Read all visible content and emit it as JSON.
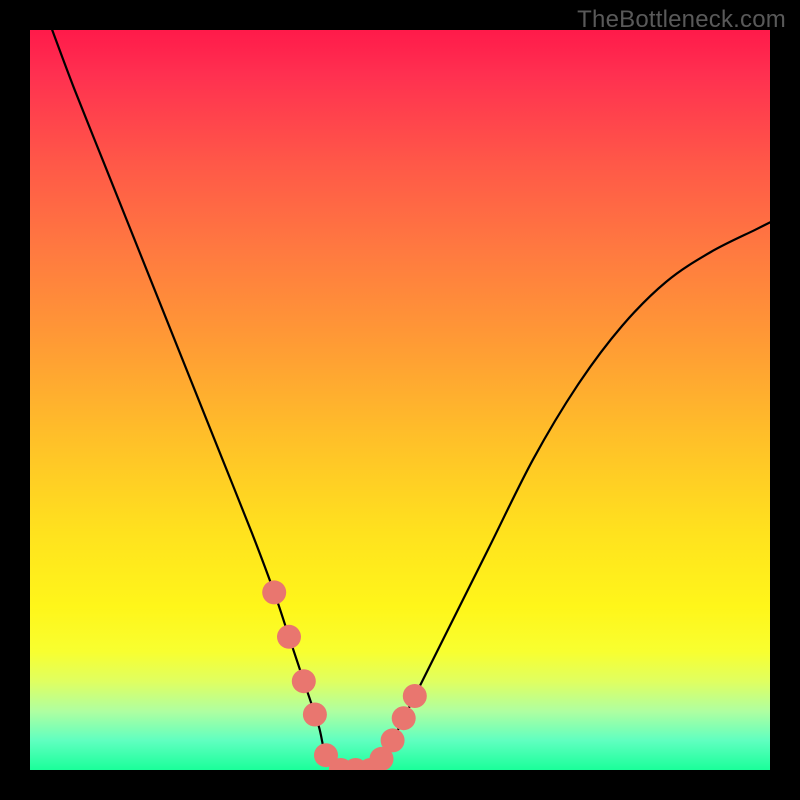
{
  "watermark": "TheBottleneck.com",
  "chart_data": {
    "type": "line",
    "title": "",
    "xlabel": "",
    "ylabel": "",
    "xlim": [
      0,
      100
    ],
    "ylim": [
      0,
      100
    ],
    "grid": false,
    "series": [
      {
        "name": "bottleneck-curve",
        "x": [
          3,
          6,
          10,
          14,
          18,
          22,
          26,
          30,
          33,
          35,
          37,
          39,
          40,
          42,
          44,
          46,
          48,
          50,
          53,
          57,
          62,
          68,
          74,
          80,
          86,
          92,
          98,
          100
        ],
        "y": [
          100,
          92,
          82,
          72,
          62,
          52,
          42,
          32,
          24,
          18,
          12,
          6,
          2,
          0,
          0,
          0,
          2,
          6,
          12,
          20,
          30,
          42,
          52,
          60,
          66,
          70,
          73,
          74
        ]
      }
    ],
    "annotations": {
      "curve_color": "#000000",
      "gradient_stops": [
        {
          "pos": 0.0,
          "color": "#ff1a4a"
        },
        {
          "pos": 0.5,
          "color": "#ffc228"
        },
        {
          "pos": 0.8,
          "color": "#fff61a"
        },
        {
          "pos": 1.0,
          "color": "#1aff9a"
        }
      ],
      "highlight_markers": {
        "color": "#e9766f",
        "points_x": [
          33,
          35,
          37,
          38.5,
          40,
          42,
          44,
          46,
          47.5,
          49,
          50.5,
          52
        ],
        "radius": 2
      }
    }
  }
}
